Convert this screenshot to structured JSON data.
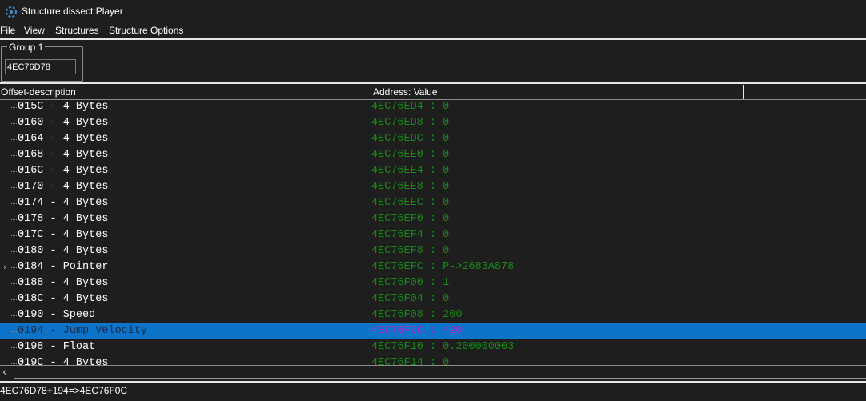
{
  "window": {
    "title": "Structure dissect:Player"
  },
  "menu": {
    "items": [
      "File",
      "View",
      "Structures",
      "Structure Options"
    ]
  },
  "group": {
    "label": "Group 1",
    "address_value": "4EC76D78"
  },
  "columns": {
    "offset": "Offset-description",
    "address": "Address: Value"
  },
  "rows": [
    {
      "desc": "015C - 4 Bytes",
      "value": "4EC76ED4 : 0",
      "selected": false,
      "expandable": false
    },
    {
      "desc": "0160 - 4 Bytes",
      "value": "4EC76ED8 : 0",
      "selected": false,
      "expandable": false
    },
    {
      "desc": "0164 - 4 Bytes",
      "value": "4EC76EDC : 0",
      "selected": false,
      "expandable": false
    },
    {
      "desc": "0168 - 4 Bytes",
      "value": "4EC76EE0 : 0",
      "selected": false,
      "expandable": false
    },
    {
      "desc": "016C - 4 Bytes",
      "value": "4EC76EE4 : 0",
      "selected": false,
      "expandable": false
    },
    {
      "desc": "0170 - 4 Bytes",
      "value": "4EC76EE8 : 0",
      "selected": false,
      "expandable": false
    },
    {
      "desc": "0174 - 4 Bytes",
      "value": "4EC76EEC : 0",
      "selected": false,
      "expandable": false
    },
    {
      "desc": "0178 - 4 Bytes",
      "value": "4EC76EF0 : 0",
      "selected": false,
      "expandable": false
    },
    {
      "desc": "017C - 4 Bytes",
      "value": "4EC76EF4 : 0",
      "selected": false,
      "expandable": false
    },
    {
      "desc": "0180 - 4 Bytes",
      "value": "4EC76EF8 : 0",
      "selected": false,
      "expandable": false
    },
    {
      "desc": "0184 - Pointer",
      "value": "4EC76EFC : P->2683A878",
      "selected": false,
      "expandable": true
    },
    {
      "desc": "0188 - 4 Bytes",
      "value": "4EC76F00 : 1",
      "selected": false,
      "expandable": false
    },
    {
      "desc": "018C - 4 Bytes",
      "value": "4EC76F04 : 0",
      "selected": false,
      "expandable": false
    },
    {
      "desc": "0190 - Speed",
      "value": "4EC76F08 : 200",
      "selected": false,
      "expandable": false
    },
    {
      "desc": "0194 - Jump Velocity",
      "value": "4EC76F0C : 420",
      "selected": true,
      "expandable": false
    },
    {
      "desc": "0198 - Float",
      "value": "4EC76F10 : 0.200000003",
      "selected": false,
      "expandable": false
    },
    {
      "desc": "019C - 4 Bytes",
      "value": "4EC76F14 : 0",
      "selected": false,
      "expandable": false
    }
  ],
  "status": {
    "text": "4EC76D78+194=>4EC76F0C"
  },
  "icons": {
    "app": "cheat-engine-icon",
    "expand": "expand-arrow-icon",
    "scroll_left": "scroll-left-arrow-icon"
  },
  "colors": {
    "selection": "#0b74c9",
    "value_text": "#178b17",
    "selected_value_text": "#b92ac4"
  }
}
